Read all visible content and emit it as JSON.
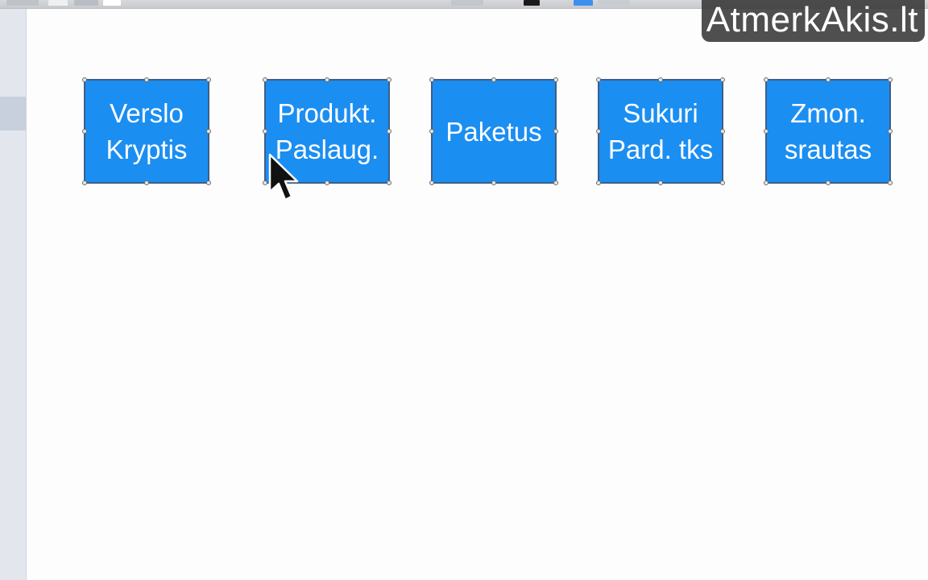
{
  "watermark": {
    "text": "AtmerkAkis.lt"
  },
  "colors": {
    "shape_fill": "#1b8ef2",
    "shape_border": "#3e5e87",
    "shape_text": "#ffffff",
    "canvas": "#fdfdfd",
    "left_panel": "#e3e7ed"
  },
  "canvas": {
    "shapes": [
      {
        "line1": "Verslo",
        "line2": "Kryptis"
      },
      {
        "line1": "Produkt.",
        "line2": "Paslaug."
      },
      {
        "line1": "Paketus",
        "line2": ""
      },
      {
        "line1": "Sukuri",
        "line2": "Pard. tks"
      },
      {
        "line1": "Zmon.",
        "line2": "srautas"
      }
    ]
  },
  "cursor": {
    "icon": "arrow-pointer-icon"
  }
}
